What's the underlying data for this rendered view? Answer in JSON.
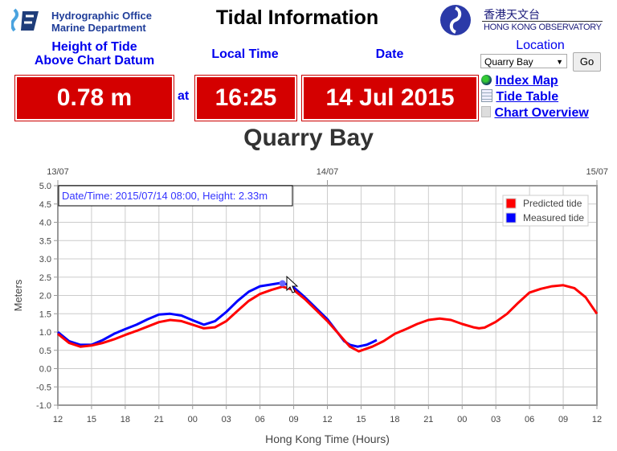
{
  "header": {
    "org_line1": "Hydrographic Office",
    "org_line2": "Marine Department",
    "title": "Tidal Information",
    "hko_chinese": "香港天文台",
    "hko_english": "HONG KONG OBSERVATORY"
  },
  "labels": {
    "height": "Height of Tide",
    "height2": "Above Chart Datum",
    "local_time": "Local Time",
    "date": "Date",
    "location": "Location",
    "at": "at"
  },
  "values": {
    "height": "0.78 m",
    "time": "16:25",
    "date": "14 Jul 2015"
  },
  "location_select": {
    "selected": "Quarry Bay",
    "go": "Go"
  },
  "links": [
    {
      "label": "Index Map",
      "icon": "globe-icon"
    },
    {
      "label": "Tide Table",
      "icon": "table-icon"
    },
    {
      "label": "Chart Overview",
      "icon": "chart-icon"
    }
  ],
  "station_title": "Quarry Bay",
  "chart_data": {
    "type": "line",
    "tooltip": "Date/Time: 2015/07/14 08:00, Height: 2.33m",
    "xlabel": "Hong Kong Time (Hours)",
    "ylabel": "Meters",
    "top_ticks": [
      "13/07",
      "14/07",
      "15/07"
    ],
    "x_ticks": [
      "12",
      "15",
      "18",
      "21",
      "00",
      "03",
      "06",
      "09",
      "12",
      "15",
      "18",
      "21",
      "00",
      "03",
      "06",
      "09",
      "12"
    ],
    "x_range": [
      "2015-07-13 12:00",
      "2015-07-15 12:00"
    ],
    "ylim": [
      -1.0,
      5.0
    ],
    "y_ticks": [
      "5.0",
      "4.5",
      "4.0",
      "3.5",
      "3.0",
      "2.5",
      "2.0",
      "1.5",
      "1.0",
      "0.5",
      "0.0",
      "-0.5",
      "-1.0"
    ],
    "grid": true,
    "legend": "top-right",
    "series": [
      {
        "name": "Predicted tide",
        "color": "#ff0000",
        "hours_from_start": [
          0,
          1,
          2,
          3,
          4,
          5,
          6,
          7,
          8,
          9,
          10,
          11,
          12,
          13,
          14,
          15,
          16,
          17,
          18,
          19,
          20,
          21,
          22,
          23,
          24,
          25,
          26,
          26.8,
          28,
          29,
          30,
          31,
          32,
          33,
          34,
          35,
          36,
          37,
          37.5,
          38,
          39,
          40,
          41,
          42,
          43,
          44,
          45,
          46,
          47,
          48
        ],
        "values": [
          0.95,
          0.7,
          0.6,
          0.63,
          0.7,
          0.8,
          0.92,
          1.03,
          1.15,
          1.27,
          1.33,
          1.3,
          1.2,
          1.1,
          1.13,
          1.3,
          1.58,
          1.85,
          2.04,
          2.15,
          2.24,
          2.15,
          1.9,
          1.6,
          1.3,
          0.95,
          0.6,
          0.47,
          0.6,
          0.75,
          0.95,
          1.08,
          1.22,
          1.33,
          1.37,
          1.33,
          1.22,
          1.13,
          1.1,
          1.12,
          1.28,
          1.5,
          1.8,
          2.08,
          2.18,
          2.25,
          2.28,
          2.2,
          1.95,
          1.5
        ]
      },
      {
        "name": "Measured tide",
        "color": "#0000ff",
        "hours_from_start": [
          0,
          1,
          2,
          3,
          4,
          5,
          6,
          7,
          8,
          9,
          10,
          11,
          12,
          13,
          14,
          15,
          16,
          17,
          18,
          19,
          20,
          21,
          22,
          23,
          24,
          25,
          25.5,
          26,
          26.7,
          27,
          27.5,
          28,
          28.4
        ],
        "values": [
          1.0,
          0.75,
          0.65,
          0.65,
          0.78,
          0.95,
          1.08,
          1.2,
          1.35,
          1.48,
          1.5,
          1.45,
          1.32,
          1.2,
          1.3,
          1.55,
          1.85,
          2.1,
          2.25,
          2.3,
          2.35,
          2.22,
          1.95,
          1.65,
          1.35,
          0.95,
          0.75,
          0.65,
          0.6,
          0.62,
          0.65,
          0.72,
          0.78
        ]
      }
    ]
  }
}
